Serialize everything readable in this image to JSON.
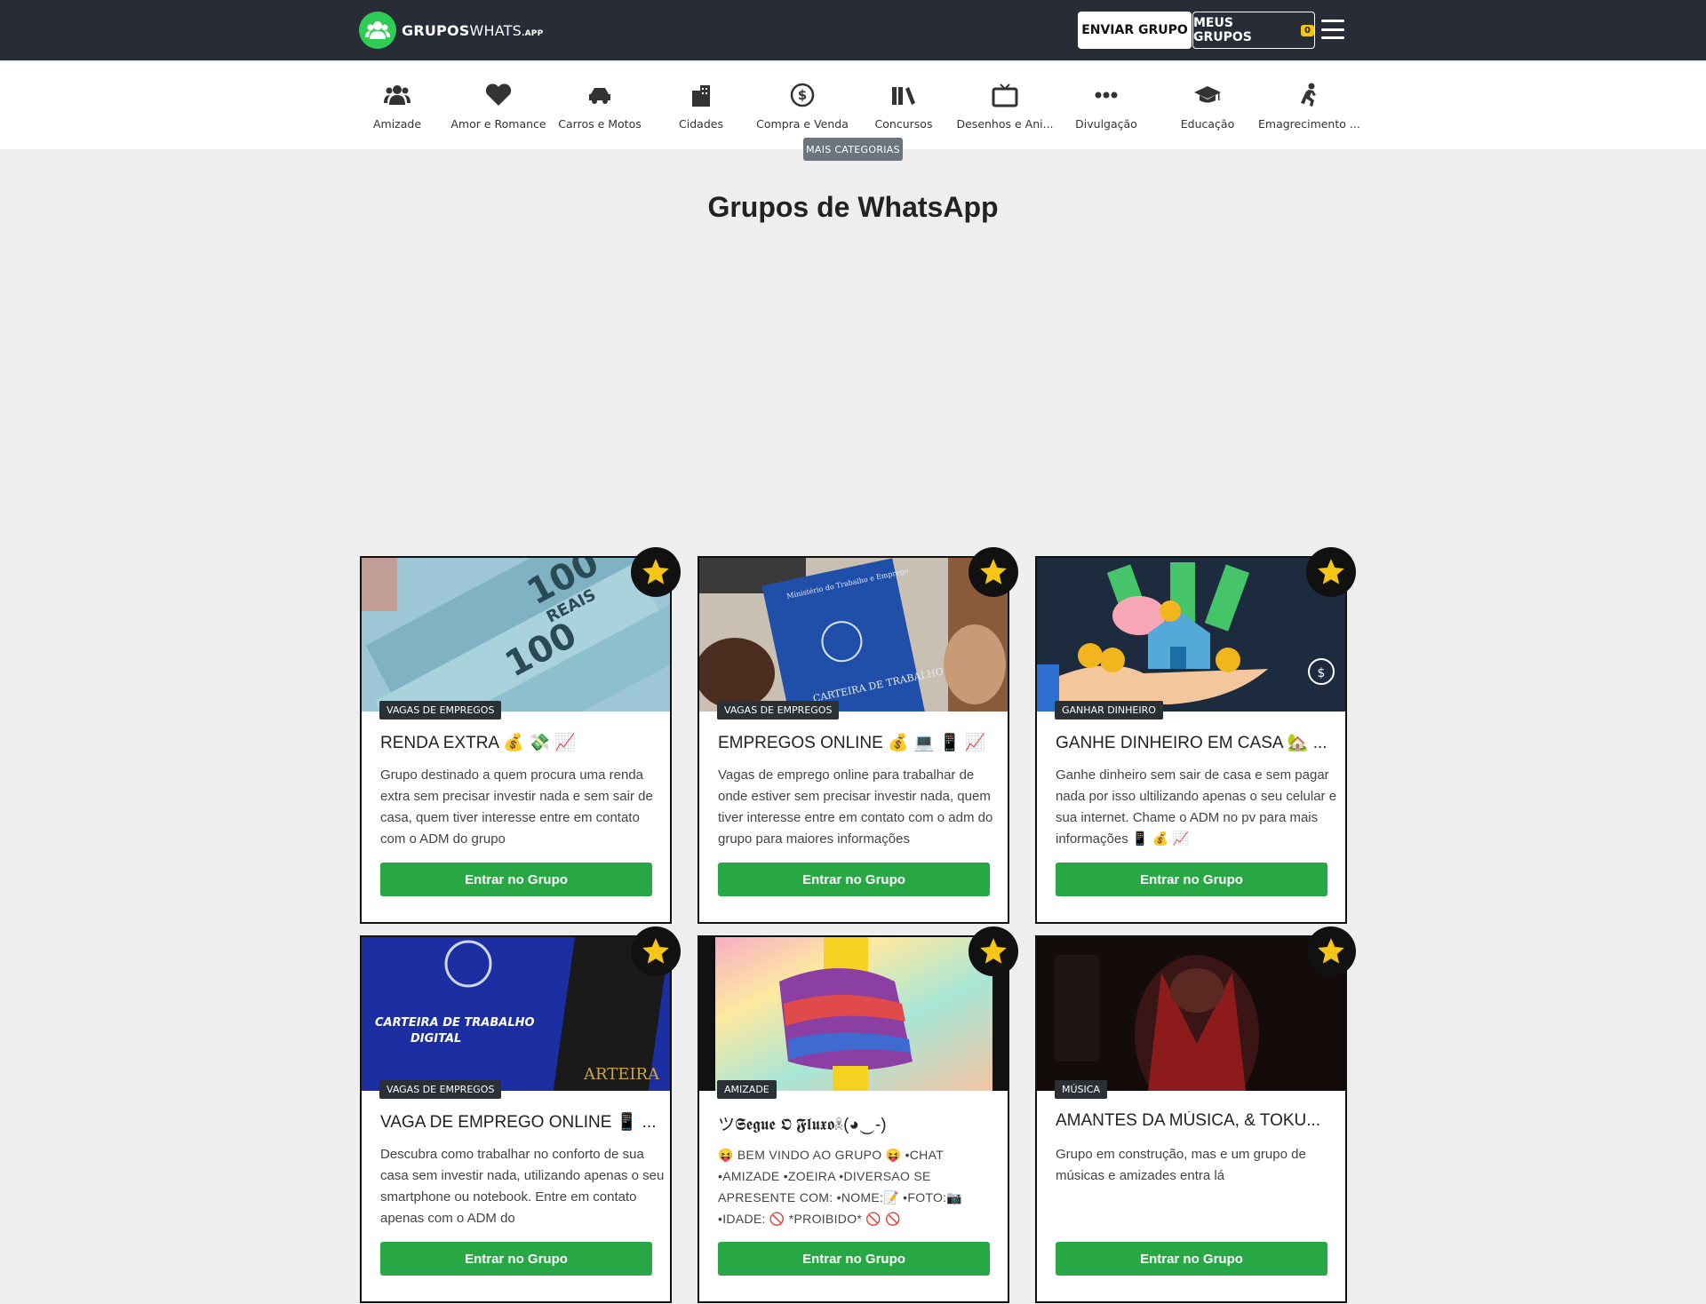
{
  "header": {
    "logo_bold": "GRUPOS",
    "logo_thin": "WHATS",
    "logo_small": ".APP",
    "send_button": "ENVIAR GRUPO",
    "my_groups_button": "MEUS GRUPOS",
    "my_groups_count": "0"
  },
  "categories": [
    {
      "label": "Amizade",
      "icon": "users-icon"
    },
    {
      "label": "Amor e Romance",
      "icon": "heart-icon"
    },
    {
      "label": "Carros e Motos",
      "icon": "car-icon"
    },
    {
      "label": "Cidades",
      "icon": "city-icon"
    },
    {
      "label": "Compra e Venda",
      "icon": "dollar-icon"
    },
    {
      "label": "Concursos",
      "icon": "books-icon"
    },
    {
      "label": "Desenhos e Ani...",
      "icon": "tv-icon"
    },
    {
      "label": "Divulgação",
      "icon": "dots-icon"
    },
    {
      "label": "Educação",
      "icon": "graduation-cap-icon"
    },
    {
      "label": "Emagrecimento ...",
      "icon": "running-icon"
    }
  ],
  "more_categories": "MAIS CATEGORIAS",
  "page_title": "Grupos de WhatsApp",
  "cards": [
    {
      "tag": "VAGAS DE EMPREGOS",
      "title": "RENDA EXTRA 💰 💸 📈",
      "desc": "Grupo destinado a quem procura uma renda extra sem precisar investir nada e sem sair de casa, quem tiver interesse entre em contato com o ADM do grupo",
      "button": "Entrar no Grupo"
    },
    {
      "tag": "VAGAS DE EMPREGOS",
      "title": "EMPREGOS ONLINE 💰 💻 📱 📈",
      "desc": "Vagas de emprego online para trabalhar de onde estiver sem precisar investir nada, quem tiver interesse entre em contato com o adm do grupo para maiores informações",
      "button": "Entrar no Grupo"
    },
    {
      "tag": "GANHAR DINHEIRO",
      "title": "GANHE DINHEIRO EM CASA 🏡 ...",
      "desc": "Ganhe dinheiro sem sair de casa e sem pagar nada por isso ultilizando apenas o seu celular e sua internet. Chame o ADM no pv para mais informações 📱 💰 📈",
      "button": "Entrar no Grupo"
    },
    {
      "tag": "VAGAS DE EMPREGOS",
      "title": "VAGA DE EMPREGO ONLINE 📱 ...",
      "desc": "Descubra como trabalhar no conforto de sua casa sem investir nada, utilizando apenas o seu smartphone ou notebook. Entre em contato apenas com o ADM do",
      "button": "Entrar no Grupo"
    },
    {
      "tag": "AMIZADE",
      "title": "ツ𝕾𝖊𝖌𝖚𝖊 𝕺 𝕱𝖑𝖚𝖝𝖔☠(◕‿-)",
      "desc": "😝 BEM VINDO AO GRUPO 😝 •CHAT •AMIZADE •ZOEIRA •DIVERSAO SE APRESENTE COM: •NOME:📝 •FOTO:📷 •IDADE: 🚫 *PROIBIDO* 🚫 🚫",
      "button": "Entrar no Grupo"
    },
    {
      "tag": "MÚSICA",
      "title": "AMANTES DA MÚSICA, & TOKU...",
      "desc": "Grupo em construção, mas e um grupo de músicas e amizades entra lá",
      "button": "Entrar no Grupo"
    }
  ],
  "colors": {
    "topbar": "#272c37",
    "accent_green": "#28a745",
    "star": "#f5c518"
  }
}
